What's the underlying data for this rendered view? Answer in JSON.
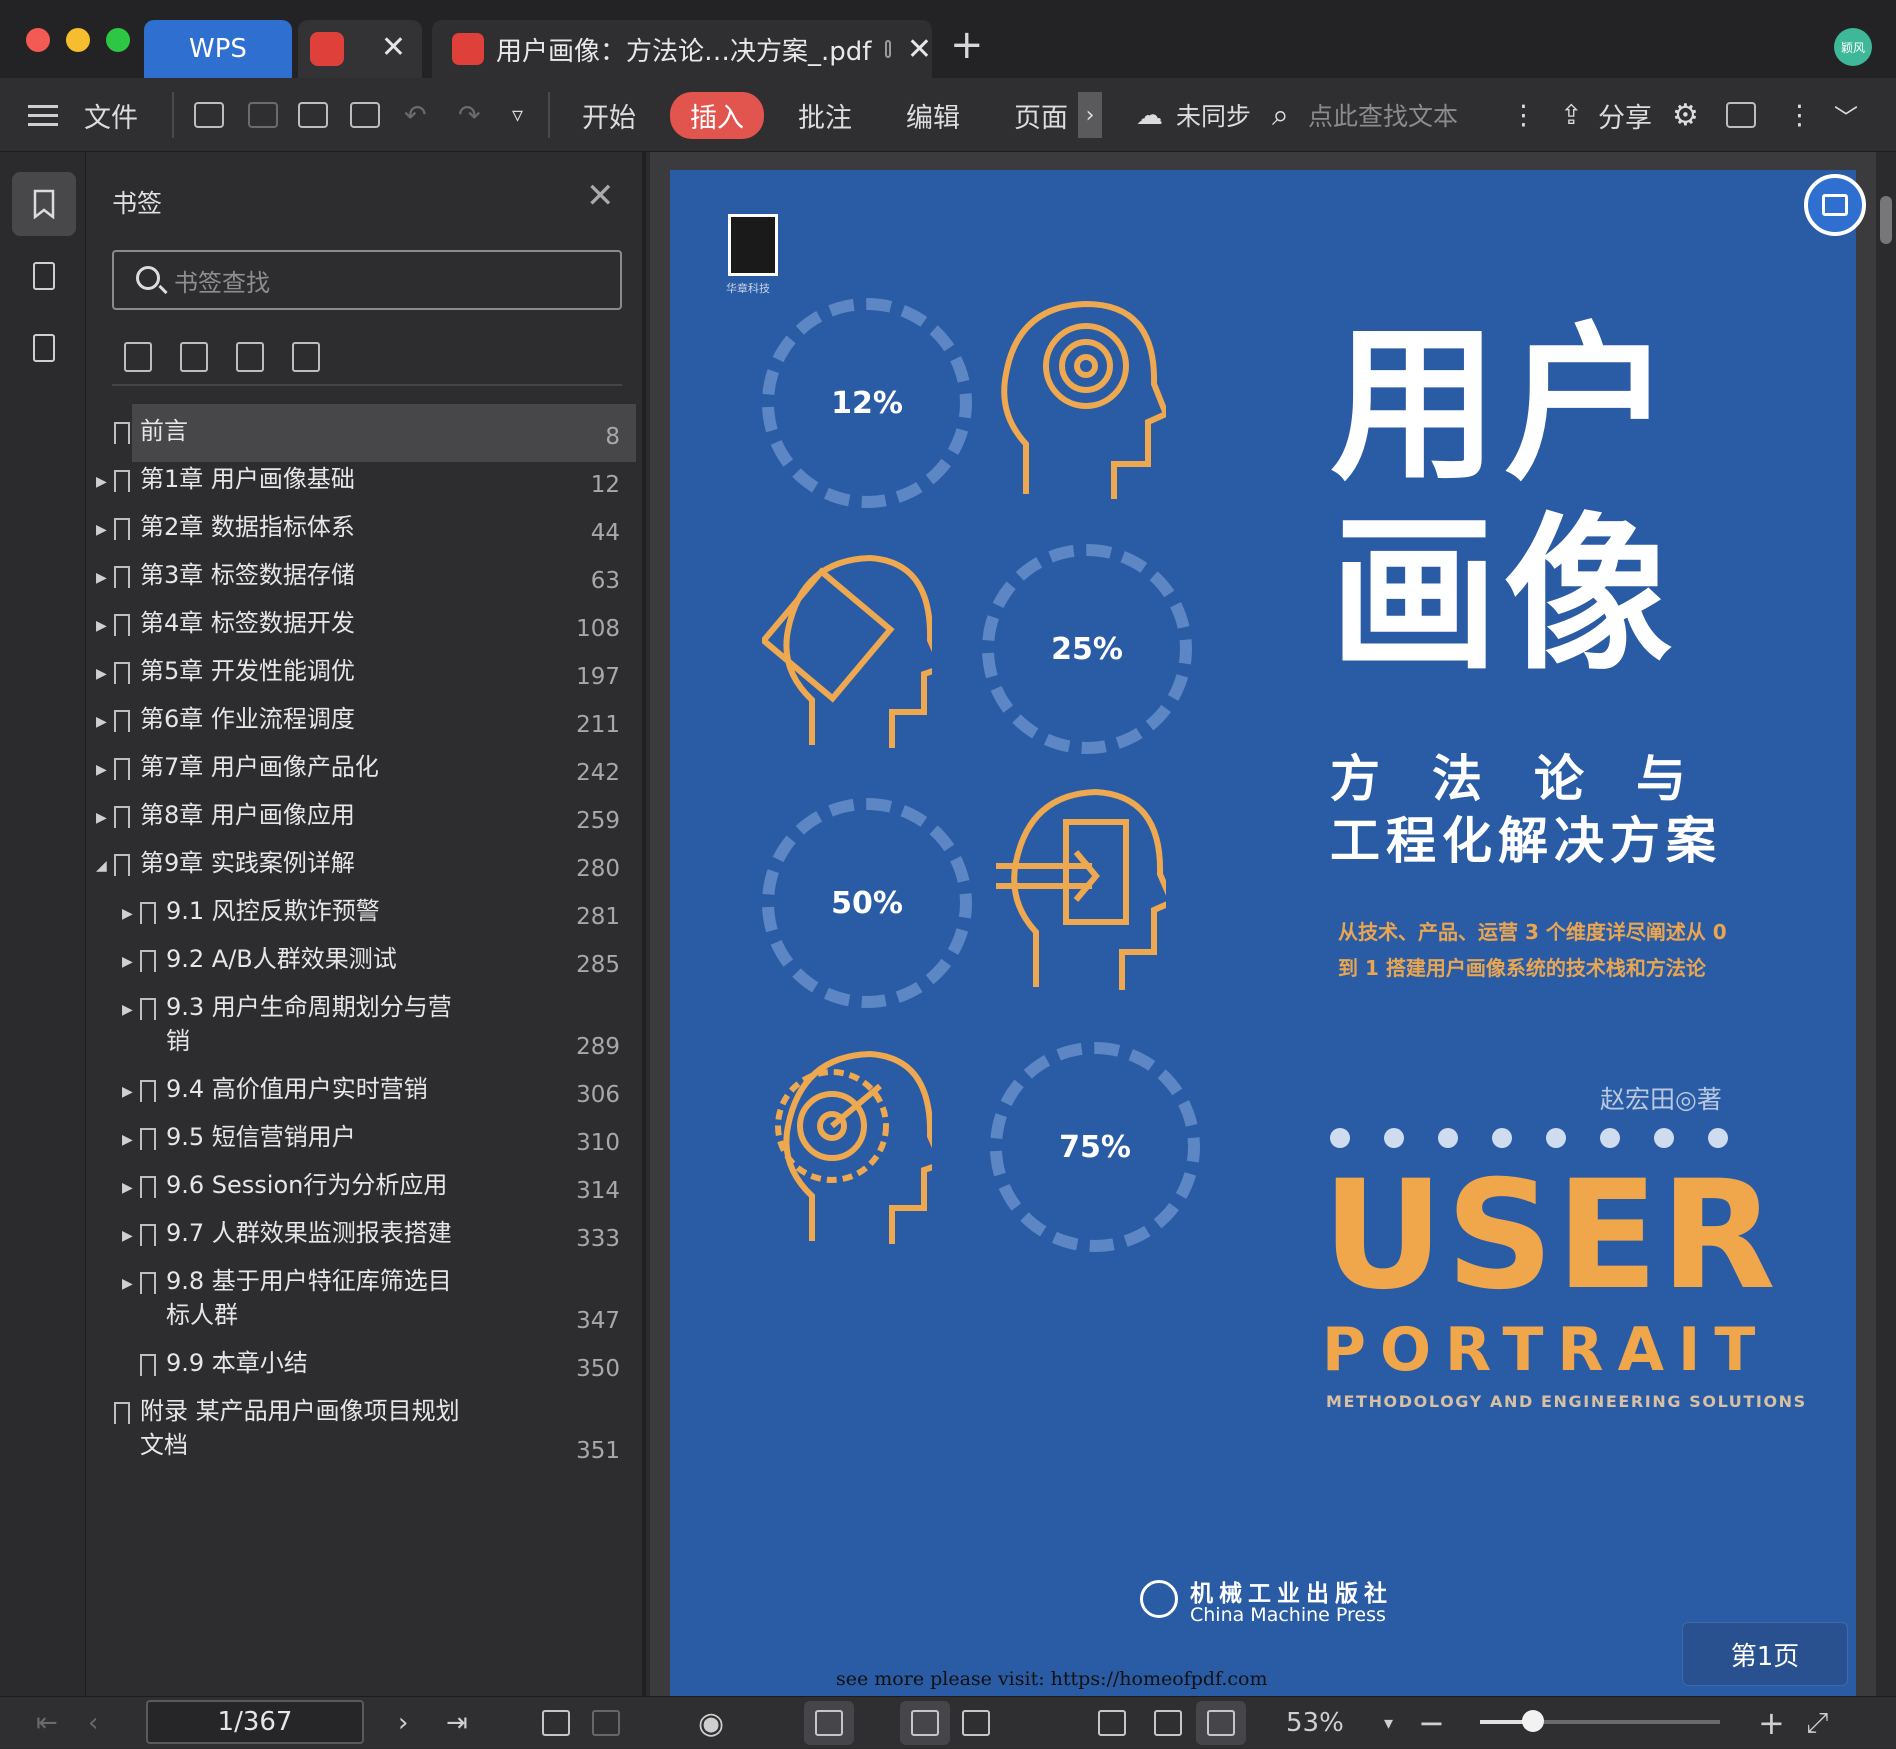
{
  "tabs": {
    "home_label": "WPS",
    "document_title": "用户画像：方法论…决方案_.pdf",
    "close_symbol": "✕",
    "add_symbol": "+",
    "user_avatar_text": "颖风"
  },
  "toolbar": {
    "file_label": "文件",
    "menu_tabs": [
      "开始",
      "插入",
      "批注",
      "编辑",
      "页面"
    ],
    "active_tab": "插入",
    "sync_status": "未同步",
    "search_placeholder": "点此查找文本",
    "share_label": "分享",
    "more_symbol": "›"
  },
  "bookmark_panel": {
    "title": "书签",
    "search_placeholder": "书签查找",
    "items": [
      {
        "label": "前言",
        "page": "8",
        "level": 0,
        "expandable": false,
        "expanded": false,
        "selected": true
      },
      {
        "label": "第1章 用户画像基础",
        "page": "12",
        "level": 0,
        "expandable": true,
        "expanded": false
      },
      {
        "label": "第2章 数据指标体系",
        "page": "44",
        "level": 0,
        "expandable": true,
        "expanded": false
      },
      {
        "label": "第3章 标签数据存储",
        "page": "63",
        "level": 0,
        "expandable": true,
        "expanded": false
      },
      {
        "label": "第4章 标签数据开发",
        "page": "108",
        "level": 0,
        "expandable": true,
        "expanded": false
      },
      {
        "label": "第5章 开发性能调优",
        "page": "197",
        "level": 0,
        "expandable": true,
        "expanded": false
      },
      {
        "label": "第6章 作业流程调度",
        "page": "211",
        "level": 0,
        "expandable": true,
        "expanded": false
      },
      {
        "label": "第7章 用户画像产品化",
        "page": "242",
        "level": 0,
        "expandable": true,
        "expanded": false
      },
      {
        "label": "第8章 用户画像应用",
        "page": "259",
        "level": 0,
        "expandable": true,
        "expanded": false
      },
      {
        "label": "第9章 实践案例详解",
        "page": "280",
        "level": 0,
        "expandable": true,
        "expanded": true
      },
      {
        "label": "9.1 风控反欺诈预警",
        "page": "281",
        "level": 1,
        "expandable": true,
        "expanded": false
      },
      {
        "label": "9.2 A/B人群效果测试",
        "page": "285",
        "level": 1,
        "expandable": true,
        "expanded": false
      },
      {
        "label": "9.3 用户生命周期划分与营销",
        "label_lines": [
          "9.3 用户生命周期划分与营",
          "销"
        ],
        "page": "289",
        "level": 1,
        "expandable": true,
        "expanded": false
      },
      {
        "label": "9.4 高价值用户实时营销",
        "page": "306",
        "level": 1,
        "expandable": true,
        "expanded": false
      },
      {
        "label": "9.5 短信营销用户",
        "page": "310",
        "level": 1,
        "expandable": true,
        "expanded": false
      },
      {
        "label": "9.6 Session行为分析应用",
        "page": "314",
        "level": 1,
        "expandable": true,
        "expanded": false
      },
      {
        "label": "9.7 人群效果监测报表搭建",
        "page": "333",
        "level": 1,
        "expandable": true,
        "expanded": false
      },
      {
        "label": "9.8 基于用户特征库筛选目标人群",
        "label_lines": [
          "9.8 基于用户特征库筛选目",
          "标人群"
        ],
        "page": "347",
        "level": 1,
        "expandable": true,
        "expanded": false
      },
      {
        "label": "9.9 本章小结",
        "page": "350",
        "level": 1,
        "expandable": false,
        "expanded": false
      },
      {
        "label": "附录 某产品用户画像项目规划文档",
        "label_lines": [
          "附录 某产品用户画像项目规划",
          "文档"
        ],
        "page": "351",
        "level": 0,
        "expandable": false,
        "expanded": false
      }
    ]
  },
  "cover": {
    "publisher_logo_text": "华章科技",
    "ring_percentages": [
      "12%",
      "25%",
      "50%",
      "75%"
    ],
    "title_lines": [
      "用户",
      "画像"
    ],
    "subtitle_line1": "方法论与",
    "subtitle_line2": "工程化解决方案",
    "description_lines": [
      "从技术、产品、运营 3 个维度详尽阐述从 0",
      "到 1 搭建用户画像系统的技术栈和方法论"
    ],
    "author": "赵宏田◎著",
    "english_title": "USER",
    "english_subtitle": "PORTRAIT",
    "english_tagline": "METHODOLOGY AND ENGINEERING SOLUTIONS",
    "press_cn": "机械工业出版社",
    "press_en": "China Machine Press",
    "watermark": "see more please visit: https://homeofpdf.com",
    "accent_orange": "#f0a64b",
    "background_blue": "#2a5ba5"
  },
  "page_chip": "第1页",
  "status_bar": {
    "page_indicator": "1/367",
    "zoom": "53%",
    "zoom_fraction": 0.22
  },
  "icons": [
    "bookmark-icon",
    "thumbnail-icon",
    "signature-icon",
    "open-folder-icon",
    "save-icon",
    "print-icon",
    "undo-icon",
    "redo-icon",
    "cloud-icon",
    "search-icon",
    "share-icon",
    "settings-icon",
    "comment-icon",
    "eye-icon",
    "fit-width-icon",
    "single-page-icon",
    "two-page-icon",
    "fullscreen-icon"
  ]
}
